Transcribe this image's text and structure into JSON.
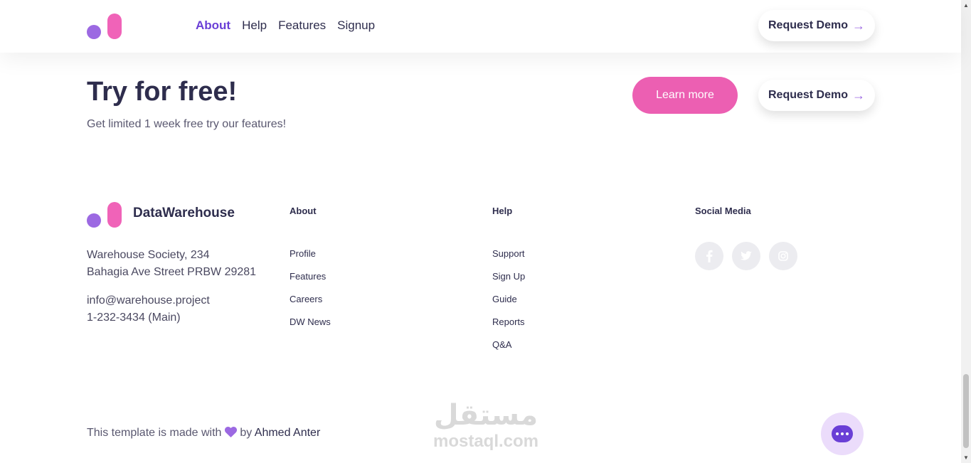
{
  "header": {
    "nav": [
      "About",
      "Help",
      "Features",
      "Signup"
    ],
    "request_demo": "Request Demo",
    "arrow": "→"
  },
  "try": {
    "title": "Try for free!",
    "subtitle": "Get limited 1 week free try our features!",
    "learn_more": "Learn more",
    "request_demo": "Request Demo",
    "arrow": "→"
  },
  "footer": {
    "brand": "DataWarehouse",
    "address": [
      "Warehouse Society, 234",
      "Bahagia Ave Street PRBW 29281"
    ],
    "contact": [
      "info@warehouse.project",
      "1-232-3434 (Main)"
    ],
    "about": {
      "title": "About",
      "links": [
        "Profile",
        "Features",
        "Careers",
        "DW News"
      ]
    },
    "help": {
      "title": "Help",
      "links": [
        "Support",
        "Sign Up",
        "Guide",
        "Reports",
        "Q&A"
      ]
    },
    "social": {
      "title": "Social Media",
      "icons": [
        "facebook-icon",
        "twitter-icon",
        "instagram-icon"
      ]
    },
    "credit_prefix": "This template is made with",
    "credit_by": "by",
    "credit_author": "Ahmed Anter"
  },
  "watermark": {
    "arabic": "مستقل",
    "latin": "mostaql.com"
  },
  "colors": {
    "accent_purple": "#6a3fd6",
    "logo_purple": "#9c69e2",
    "logo_pink": "#f063b8",
    "button_pink": "#ec5fb2"
  }
}
